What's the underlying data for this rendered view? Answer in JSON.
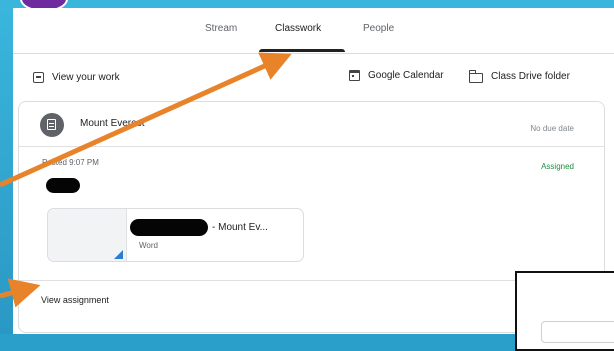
{
  "tabs": [
    {
      "label": "Stream"
    },
    {
      "label": "Classwork"
    },
    {
      "label": "People"
    }
  ],
  "toolbar": {
    "view_work": "View your work",
    "calendar": "Google Calendar",
    "drive": "Class Drive folder"
  },
  "assignment": {
    "title": "Mount Everest",
    "due": "No due date",
    "posted": "Posted 9:07 PM",
    "status": "Assigned",
    "attachment_title": "- Mount Ev...",
    "attachment_type": "Word",
    "view_label": "View assignment"
  },
  "icons": [
    "assignment-icon",
    "view-work-icon",
    "calendar-icon",
    "folder-icon",
    "word-file-icon"
  ],
  "colors": {
    "accent_green": "#1e8e3e",
    "arrow": "#e8832a",
    "background": "#2a9fc9",
    "word_blue": "#2b7cd3"
  }
}
